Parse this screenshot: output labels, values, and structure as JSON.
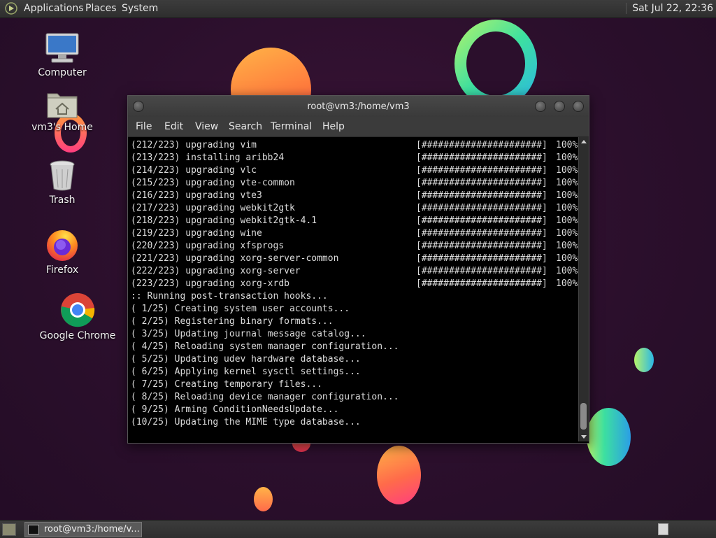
{
  "top_panel": {
    "menu": [
      "Applications",
      "Places",
      "System"
    ],
    "clock": "Sat Jul 22, 22:36"
  },
  "desktop_icons": [
    {
      "label": "Computer",
      "icon": "computer-icon"
    },
    {
      "label": "vm3's Home",
      "icon": "home-folder-icon"
    },
    {
      "label": "Trash",
      "icon": "trash-icon"
    },
    {
      "label": "Firefox",
      "icon": "firefox-icon"
    },
    {
      "label": "Google Chrome",
      "icon": "chrome-icon"
    }
  ],
  "window": {
    "title": "root@vm3:/home/vm3",
    "menu": [
      "File",
      "Edit",
      "View",
      "Search",
      "Terminal",
      "Help"
    ]
  },
  "terminal": {
    "package_lines": [
      {
        "text": "(212/223) upgrading vim",
        "bar": "[######################]",
        "pct": "100%"
      },
      {
        "text": "(213/223) installing aribb24",
        "bar": "[######################]",
        "pct": "100%"
      },
      {
        "text": "(214/223) upgrading vlc",
        "bar": "[######################]",
        "pct": "100%"
      },
      {
        "text": "(215/223) upgrading vte-common",
        "bar": "[######################]",
        "pct": "100%"
      },
      {
        "text": "(216/223) upgrading vte3",
        "bar": "[######################]",
        "pct": "100%"
      },
      {
        "text": "(217/223) upgrading webkit2gtk",
        "bar": "[######################]",
        "pct": "100%"
      },
      {
        "text": "(218/223) upgrading webkit2gtk-4.1",
        "bar": "[######################]",
        "pct": "100%"
      },
      {
        "text": "(219/223) upgrading wine",
        "bar": "[######################]",
        "pct": "100%"
      },
      {
        "text": "(220/223) upgrading xfsprogs",
        "bar": "[######################]",
        "pct": "100%"
      },
      {
        "text": "(221/223) upgrading xorg-server-common",
        "bar": "[######################]",
        "pct": "100%"
      },
      {
        "text": "(222/223) upgrading xorg-server",
        "bar": "[######################]",
        "pct": "100%"
      },
      {
        "text": "(223/223) upgrading xorg-xrdb",
        "bar": "[######################]",
        "pct": "100%"
      }
    ],
    "hook_lines": [
      ":: Running post-transaction hooks...",
      "( 1/25) Creating system user accounts...",
      "( 2/25) Registering binary formats...",
      "( 3/25) Updating journal message catalog...",
      "( 4/25) Reloading system manager configuration...",
      "( 5/25) Updating udev hardware database...",
      "( 6/25) Applying kernel sysctl settings...",
      "( 7/25) Creating temporary files...",
      "( 8/25) Reloading device manager configuration...",
      "( 9/25) Arming ConditionNeedsUpdate...",
      "(10/25) Updating the MIME type database..."
    ]
  },
  "bottom_panel": {
    "task_label": "root@vm3:/home/v..."
  }
}
